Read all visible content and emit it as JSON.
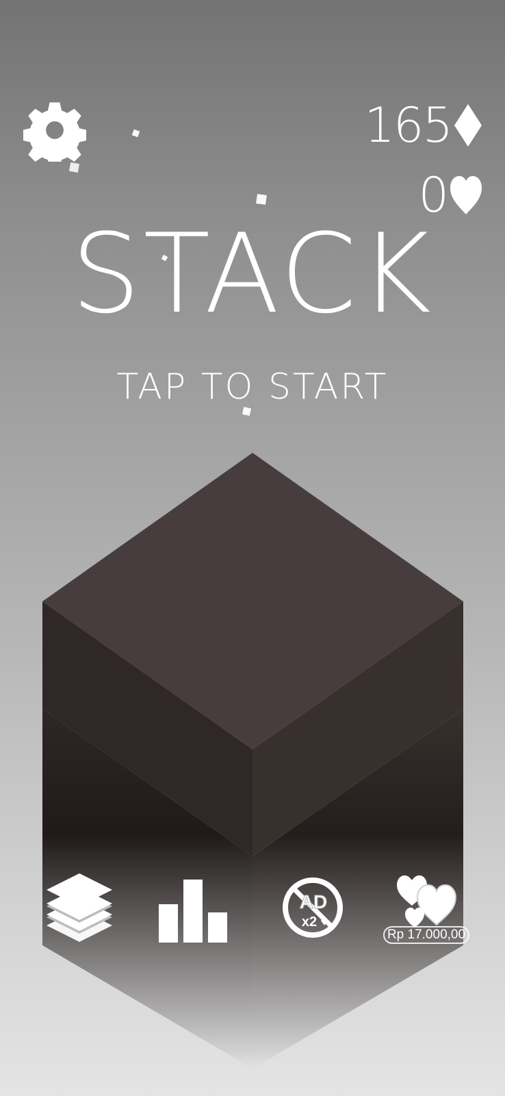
{
  "header": {
    "diamonds_count": "165",
    "diamond_icon": "diamond-icon",
    "hearts_count": "0",
    "heart_icon": "heart-icon",
    "settings_icon": "gear-icon"
  },
  "main": {
    "title": "STACK",
    "prompt": "TAP TO START"
  },
  "bottom_bar": {
    "themes_icon": "layers-icon",
    "leaderboard_icon": "leaderboard-icon",
    "no_ads_icon": "no-ads-x2-icon",
    "no_ads_text": "AD",
    "no_ads_multiplier": "x2",
    "shop_icon": "hearts-shop-icon",
    "shop_price": "Rp 17.000,00"
  },
  "colors": {
    "cube_top": "#473d3f",
    "cube_left": "#2f2826",
    "cube_right": "#38302d",
    "text": "#ffffff"
  }
}
